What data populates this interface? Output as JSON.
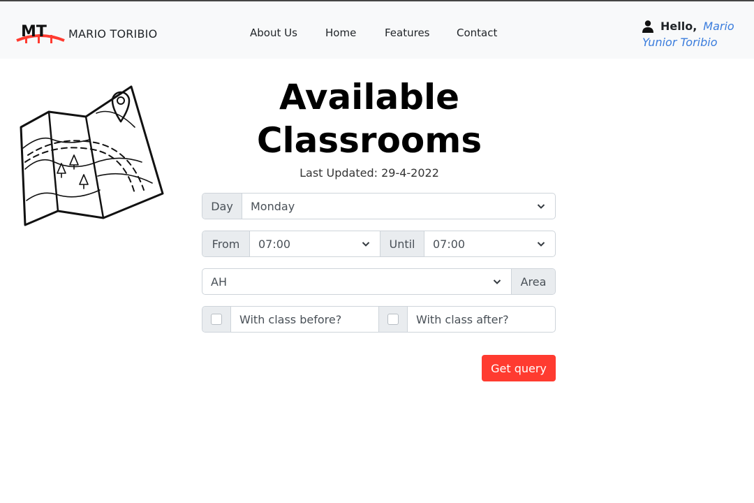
{
  "brand": {
    "name": "MARIO TORIBIO",
    "logo_icon": "mt-logo-icon",
    "logo_text": "MT",
    "logo_color": "#ff3b30"
  },
  "nav": {
    "links": [
      {
        "label": "About Us"
      },
      {
        "label": "Home"
      },
      {
        "label": "Features"
      },
      {
        "label": "Contact"
      }
    ]
  },
  "user": {
    "icon": "user-icon",
    "greeting": "Hello,",
    "name_line1": "Mario",
    "name_line2": "Yunior Toribio",
    "name_color": "#3b7ddd"
  },
  "main": {
    "illustration": "folded-map-illustration",
    "title_line1": "Available",
    "title_line2": "Classrooms",
    "last_updated": "Last Updated: 29-4-2022"
  },
  "form": {
    "day": {
      "label": "Day",
      "value": "Monday"
    },
    "from": {
      "label": "From",
      "value": "07:00"
    },
    "until": {
      "label": "Until",
      "value": "07:00"
    },
    "area": {
      "value": "AH",
      "label": "Area"
    },
    "with_class_before": {
      "label": "With class before?",
      "checked": false
    },
    "with_class_after": {
      "label": "With class after?",
      "checked": false
    },
    "submit_label": "Get query"
  },
  "colors": {
    "navbar_bg": "#f8f9fa",
    "addon_bg": "#e9ecef",
    "button_bg": "#ff3b30"
  }
}
